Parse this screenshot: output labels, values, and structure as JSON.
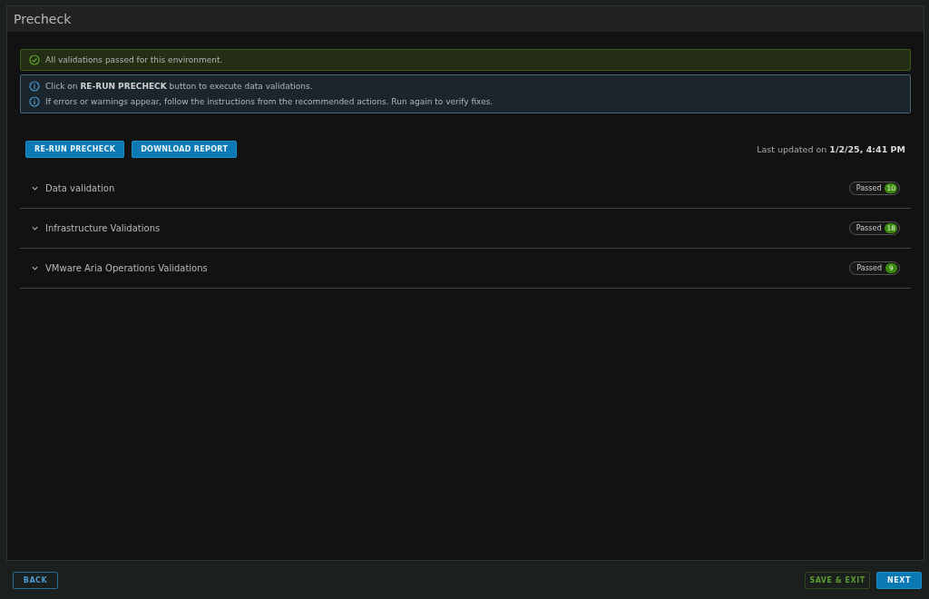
{
  "window": {
    "title": "Precheck"
  },
  "success_alert": {
    "text": "All validations passed for this environment."
  },
  "info_alert": {
    "lines": [
      "Click on **RE-RUN PRECHECK** button to execute data validations.",
      "If errors or warnings appear, follow the instructions from the recommended actions. Run again to verify fixes."
    ]
  },
  "actions": [
    "RE-RUN PRECHECK",
    "DOWNLOAD REPORT"
  ],
  "last_updated": {
    "label": "Last updated on",
    "value": "1/2/25, 4:41 PM"
  },
  "sections": [
    {
      "title": "Data validation",
      "status": "Passed",
      "count": "10"
    },
    {
      "title": "Infrastructure Validations",
      "status": "Passed",
      "count": "18"
    },
    {
      "title": "VMware Aria Operations Validations",
      "status": "Passed",
      "count": "9"
    }
  ],
  "footer": {
    "left": [
      {
        "label": "BACK",
        "kind": "outline"
      }
    ],
    "right": [
      {
        "label": "SAVE & EXIT",
        "kind": "success-outline"
      },
      {
        "label": "NEXT",
        "kind": "primary"
      }
    ]
  }
}
